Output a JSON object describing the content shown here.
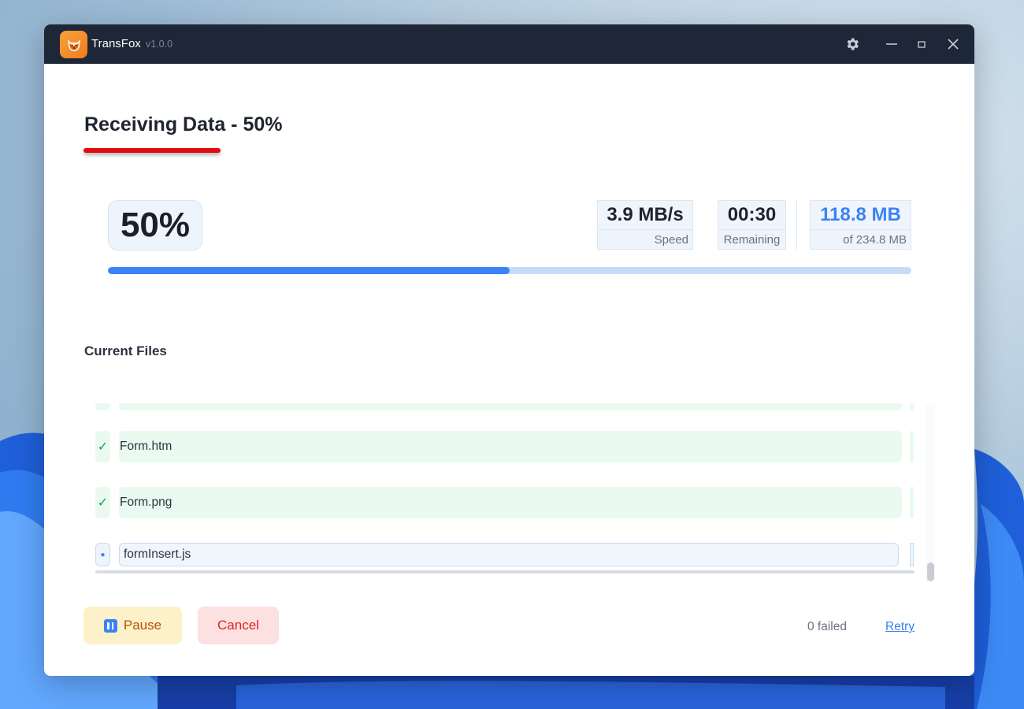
{
  "app": {
    "name": "TransFox",
    "version": "v1.0.0"
  },
  "window_controls": {
    "settings_icon": "gear-icon",
    "minimize_icon": "minimize-icon",
    "maximize_icon": "maximize-icon",
    "close_icon": "close-icon"
  },
  "heading": "Receiving Data - 50%",
  "progress": {
    "percent_label": "50%",
    "fraction": 0.5,
    "speed_value": "3.9 MB/s",
    "speed_label": "Speed",
    "remaining_value": "00:30",
    "remaining_label": "Remaining",
    "transferred_value": "118.8 MB",
    "total_label": "of 234.8 MB"
  },
  "files_section": {
    "title": "Current Files",
    "files": [
      {
        "name": "",
        "status": "done"
      },
      {
        "name": "Form.htm",
        "status": "done",
        "status_glyph": "✓"
      },
      {
        "name": "Form.png",
        "status": "done",
        "status_glyph": "✓"
      },
      {
        "name": "formInsert.js",
        "status": "active",
        "status_glyph": "●"
      }
    ]
  },
  "footer": {
    "pause_label": "Pause",
    "cancel_label": "Cancel",
    "failed_text": "0 failed",
    "retry_label": "Retry"
  },
  "colors": {
    "accent": "#3b82f6",
    "titlebar": "#1e2738",
    "done": "#16a34a",
    "heading_underline": "#e00d0d"
  }
}
